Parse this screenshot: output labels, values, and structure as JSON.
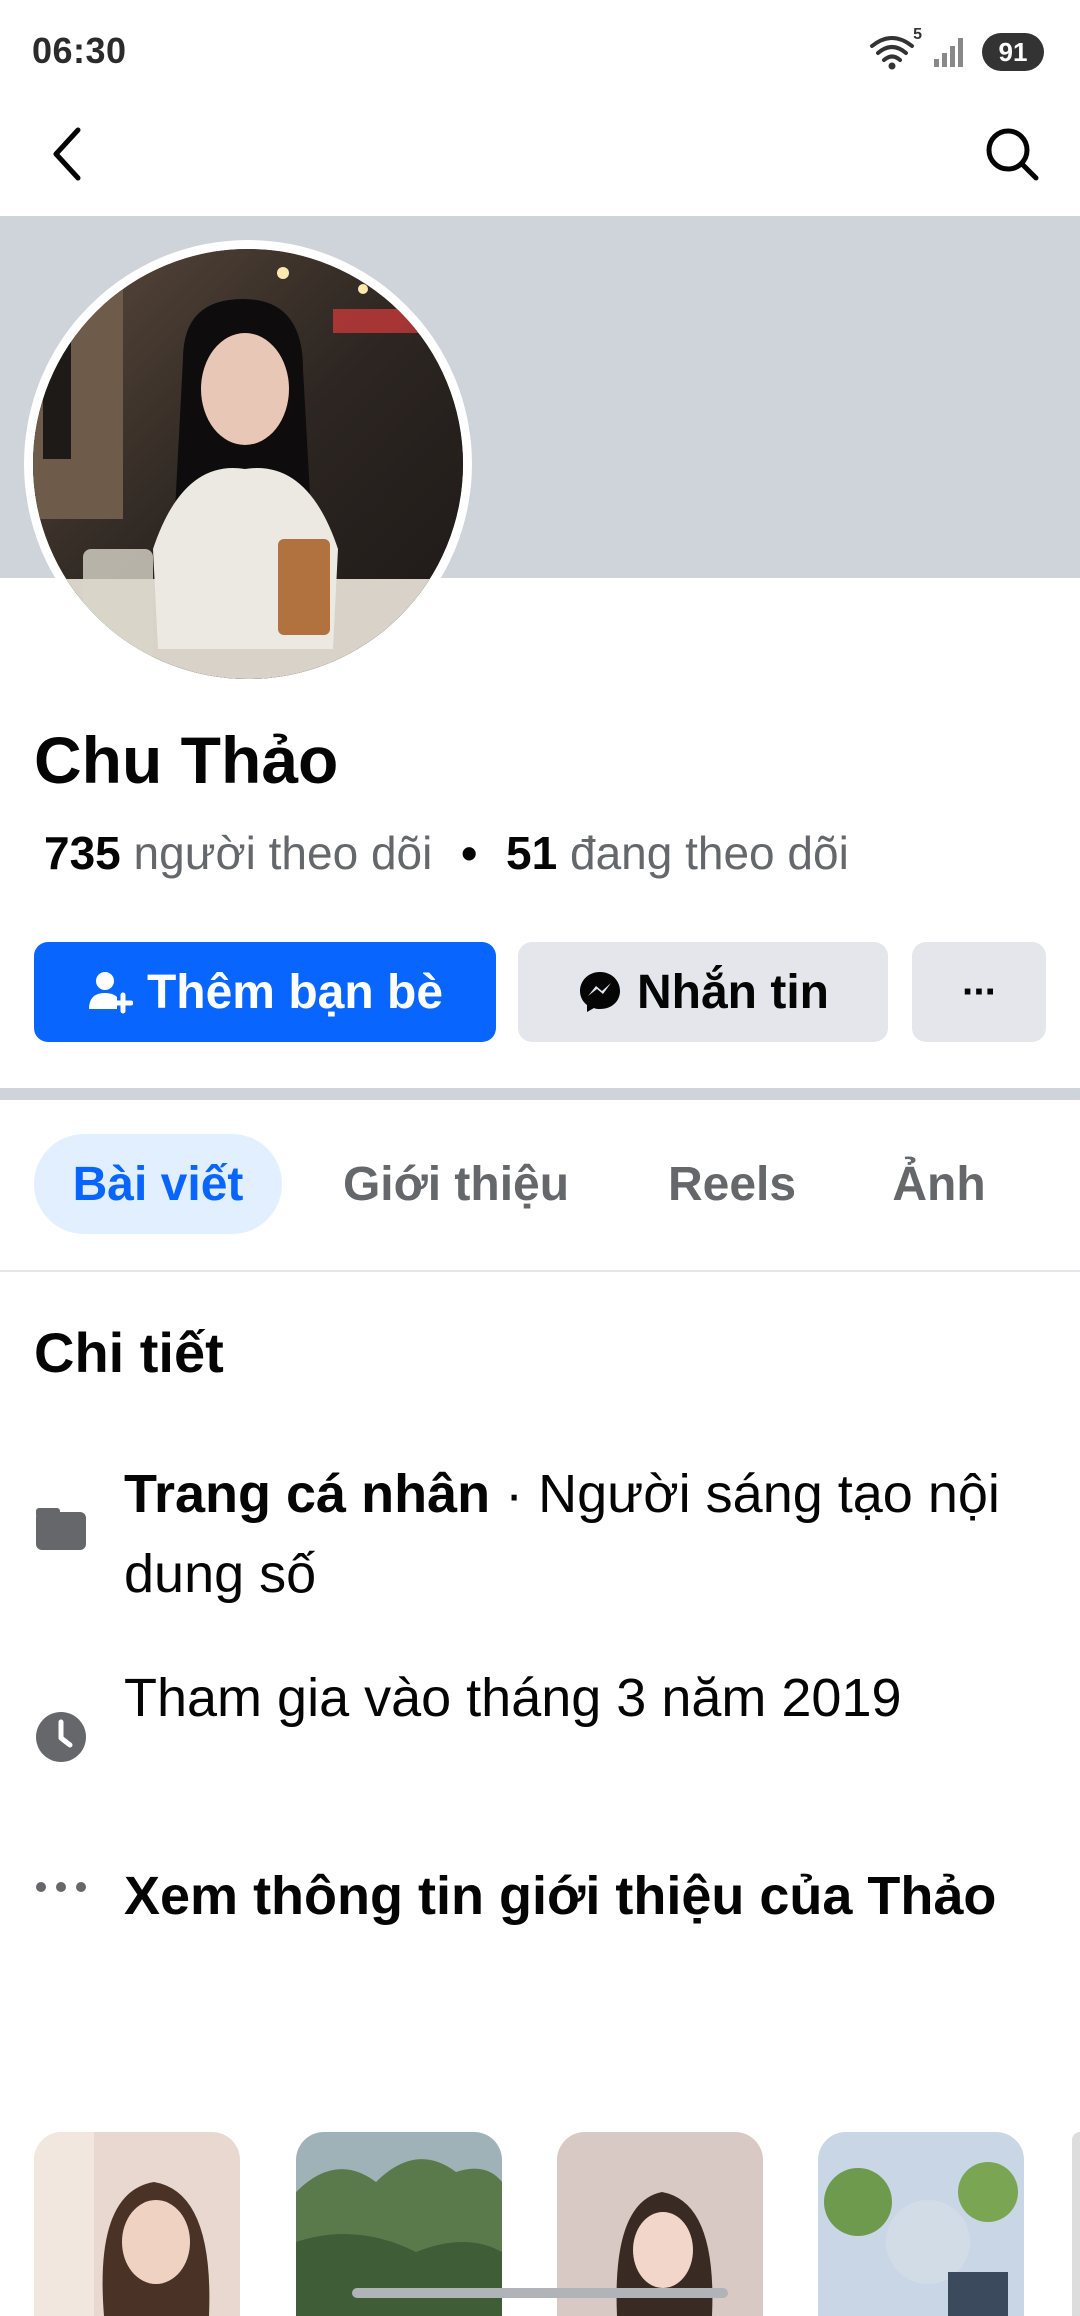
{
  "status_bar": {
    "time": "06:30",
    "battery": "91",
    "wifi_badge": "5"
  },
  "nav": {
    "back_icon": "chevron-left-icon",
    "search_icon": "search-icon"
  },
  "profile": {
    "name": "Chu Thảo",
    "followers_count": "735",
    "followers_label": "người theo dõi",
    "separator": "•",
    "following_count": "51",
    "following_label": "đang theo dõi"
  },
  "actions": {
    "add_friend": "Thêm bạn bè",
    "message": "Nhắn tin",
    "more": "···"
  },
  "tabs": [
    {
      "label": "Bài viết",
      "active": true
    },
    {
      "label": "Giới thiệu",
      "active": false
    },
    {
      "label": "Reels",
      "active": false
    },
    {
      "label": "Ảnh",
      "active": false
    }
  ],
  "details": {
    "title": "Chi tiết",
    "page_type_bold": "Trang cá nhân",
    "page_type_rest": " · Người sáng tạo nội dung số",
    "joined": "Tham gia vào tháng 3 năm 2019",
    "see_about": "Xem thông tin giới thiệu của Thảo",
    "see_about_icon": "ellipsis-icon"
  },
  "colors": {
    "accent": "#0866ff",
    "cover": "#cfd3da",
    "secondary_button": "#e4e6eb",
    "muted_text": "#65676b"
  }
}
